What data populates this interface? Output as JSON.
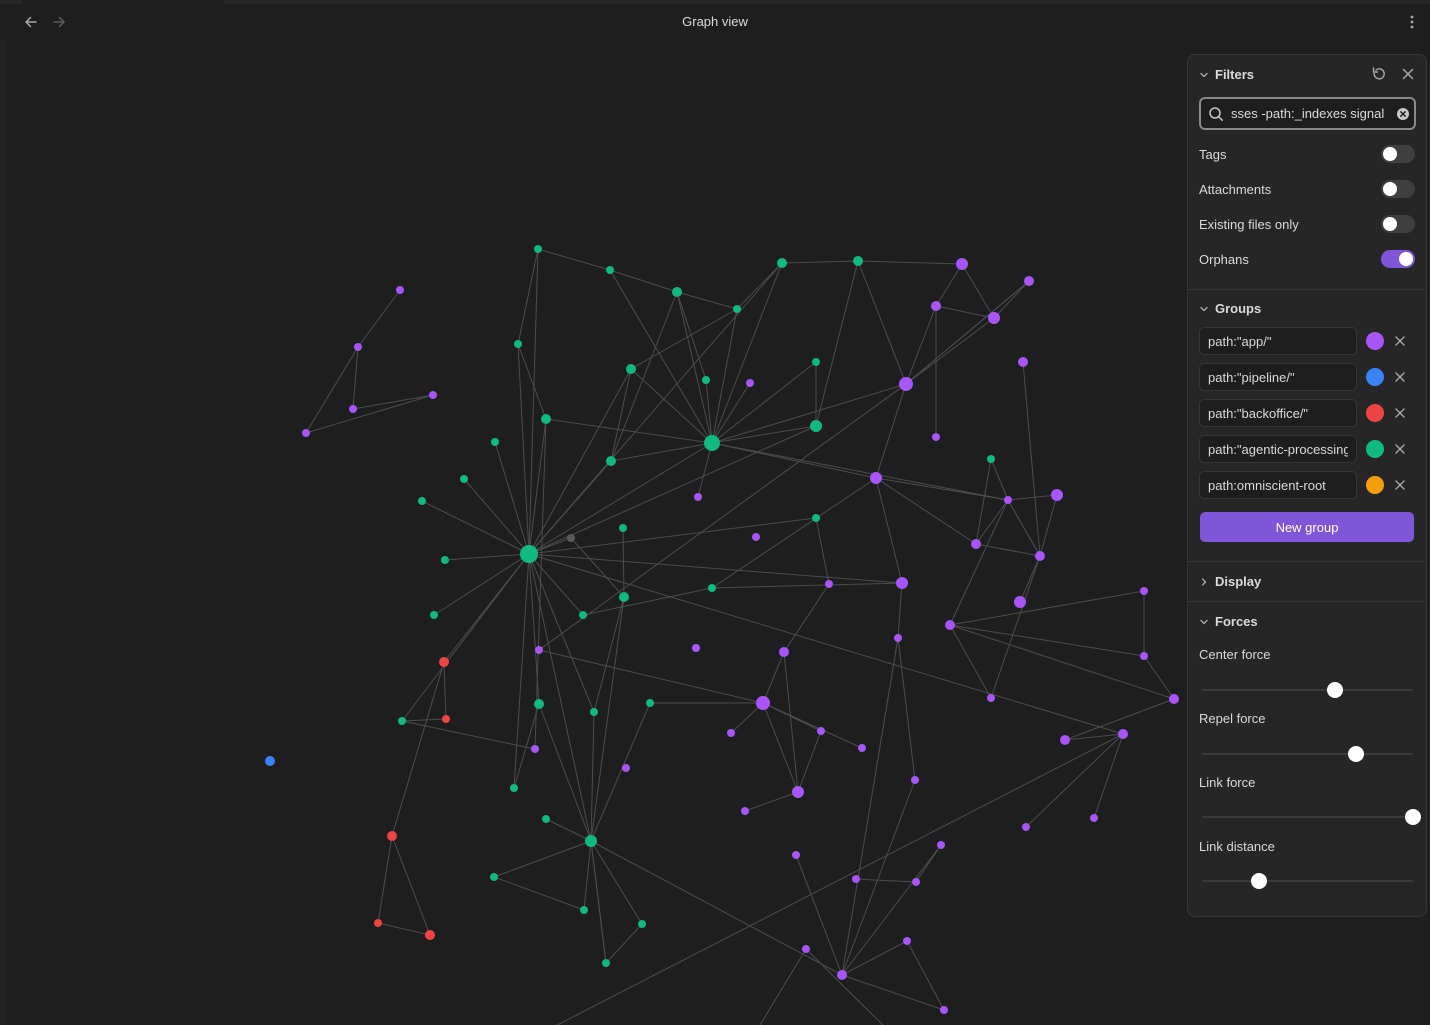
{
  "view": {
    "title": "Graph view"
  },
  "filters": {
    "title": "Filters",
    "search": {
      "value": "sses -path:_indexes signal"
    },
    "toggles": [
      {
        "label": "Tags",
        "on": false
      },
      {
        "label": "Attachments",
        "on": false
      },
      {
        "label": "Existing files only",
        "on": false
      },
      {
        "label": "Orphans",
        "on": true
      }
    ]
  },
  "groups": {
    "title": "Groups",
    "items": [
      {
        "query": "path:\"app/\"",
        "color": "#a855f7"
      },
      {
        "query": "path:\"pipeline/\"",
        "color": "#3b82f6"
      },
      {
        "query": "path:\"backoffice/\"",
        "color": "#ef4444"
      },
      {
        "query": "path:\"agentic-processing",
        "color": "#10b981"
      },
      {
        "query": "path:omniscient-root",
        "color": "#f59e0b"
      }
    ],
    "new_group_label": "New group"
  },
  "display": {
    "title": "Display"
  },
  "forces": {
    "title": "Forces",
    "sliders": [
      {
        "label": "Center force",
        "value": 0.63
      },
      {
        "label": "Repel force",
        "value": 0.73
      },
      {
        "label": "Link force",
        "value": 1.0
      },
      {
        "label": "Link distance",
        "value": 0.27
      }
    ]
  },
  "colors": {
    "accent": "#7f56d9",
    "node_app": "#a855f7",
    "node_pipeline": "#3b82f6",
    "node_backoffice": "#ef4444",
    "node_agentic": "#10b981",
    "node_ungrouped": "#5a5a5a",
    "edge": "#4d4d4d"
  }
}
